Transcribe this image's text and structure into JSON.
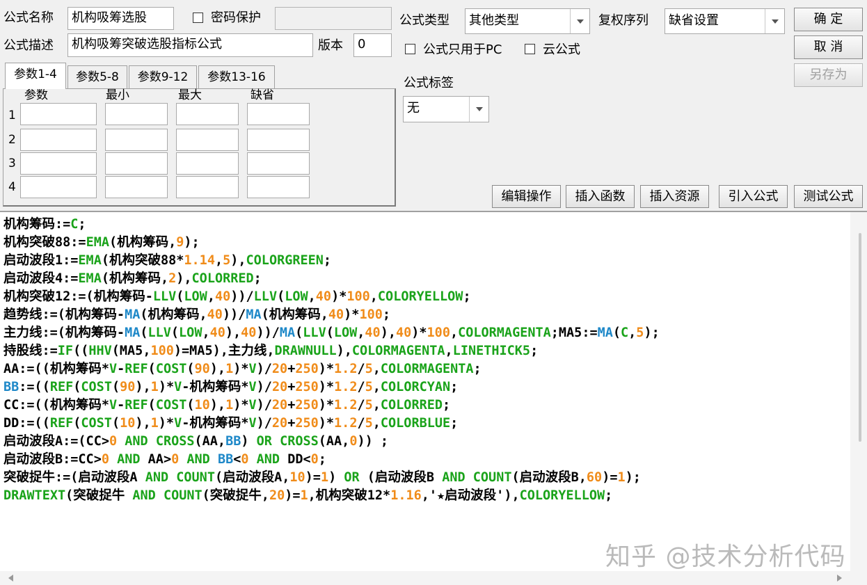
{
  "form": {
    "name_label": "公式名称",
    "name_value": "机构吸筹选股",
    "password_label": "密码保护",
    "password_value": "",
    "desc_label": "公式描述",
    "desc_value": "机构吸筹突破选股指标公式",
    "version_label": "版本",
    "version_value": "0"
  },
  "right": {
    "type_label": "公式类型",
    "type_value": "其他类型",
    "rights_label": "复权序列",
    "rights_value": "缺省设置",
    "pc_only_label": "公式只用于PC",
    "cloud_label": "云公式",
    "tag_label": "公式标签",
    "tag_value": "无"
  },
  "buttons": {
    "ok": "确  定",
    "cancel": "取  消",
    "save_as": "另存为",
    "edit_ops": "编辑操作",
    "insert_func": "插入函数",
    "insert_res": "插入资源",
    "import_formula": "引入公式",
    "test_formula": "测试公式"
  },
  "params": {
    "tabs": [
      "参数1-4",
      "参数5-8",
      "参数9-12",
      "参数13-16"
    ],
    "active_tab": 0,
    "headers": [
      "参数",
      "最小",
      "最大",
      "缺省"
    ],
    "rows": [
      "1",
      "2",
      "3",
      "4"
    ]
  },
  "colors": {
    "default": "#000000",
    "func": "#1aa31a",
    "num": "#f08c1a",
    "blue": "#1e88c8",
    "comment": "#000000"
  },
  "code_lines": [
    [
      [
        "机构筹码:=",
        "default"
      ],
      [
        "C",
        "func"
      ],
      [
        ";",
        "default"
      ]
    ],
    [
      [
        "机构突破88:=",
        "default"
      ],
      [
        "EMA",
        "func"
      ],
      [
        "(机构筹码,",
        "default"
      ],
      [
        "9",
        "num"
      ],
      [
        ");",
        "default"
      ]
    ],
    [
      [
        "启动波段1:=",
        "default"
      ],
      [
        "EMA",
        "func"
      ],
      [
        "(机构突破88*",
        "default"
      ],
      [
        "1.14",
        "num"
      ],
      [
        ",",
        "default"
      ],
      [
        "5",
        "num"
      ],
      [
        "),",
        "default"
      ],
      [
        "COLORGREEN",
        "func"
      ],
      [
        ";",
        "default"
      ]
    ],
    [
      [
        "启动波段4:=",
        "default"
      ],
      [
        "EMA",
        "func"
      ],
      [
        "(机构筹码,",
        "default"
      ],
      [
        "2",
        "num"
      ],
      [
        "),",
        "default"
      ],
      [
        "COLORRED",
        "func"
      ],
      [
        ";",
        "default"
      ]
    ],
    [
      [
        "机构突破12:=(机构筹码-",
        "default"
      ],
      [
        "LLV",
        "func"
      ],
      [
        "(",
        "default"
      ],
      [
        "LOW",
        "func"
      ],
      [
        ",",
        "default"
      ],
      [
        "40",
        "num"
      ],
      [
        "))/",
        "default"
      ],
      [
        "LLV",
        "func"
      ],
      [
        "(",
        "default"
      ],
      [
        "LOW",
        "func"
      ],
      [
        ",",
        "default"
      ],
      [
        "40",
        "num"
      ],
      [
        ")*",
        "default"
      ],
      [
        "100",
        "num"
      ],
      [
        ",",
        "default"
      ],
      [
        "COLORYELLOW",
        "func"
      ],
      [
        ";",
        "default"
      ]
    ],
    [
      [
        "趋势线:=(机构筹码-",
        "default"
      ],
      [
        "MA",
        "blue"
      ],
      [
        "(机构筹码,",
        "default"
      ],
      [
        "40",
        "num"
      ],
      [
        "))/",
        "default"
      ],
      [
        "MA",
        "blue"
      ],
      [
        "(机构筹码,",
        "default"
      ],
      [
        "40",
        "num"
      ],
      [
        ")*",
        "default"
      ],
      [
        "100",
        "num"
      ],
      [
        ";",
        "default"
      ]
    ],
    [
      [
        "主力线:=(机构筹码-",
        "default"
      ],
      [
        "MA",
        "blue"
      ],
      [
        "(",
        "default"
      ],
      [
        "LLV",
        "func"
      ],
      [
        "(",
        "default"
      ],
      [
        "LOW",
        "func"
      ],
      [
        ",",
        "default"
      ],
      [
        "40",
        "num"
      ],
      [
        "),",
        "default"
      ],
      [
        "40",
        "num"
      ],
      [
        "))/",
        "default"
      ],
      [
        "MA",
        "blue"
      ],
      [
        "(",
        "default"
      ],
      [
        "LLV",
        "func"
      ],
      [
        "(",
        "default"
      ],
      [
        "LOW",
        "func"
      ],
      [
        ",",
        "default"
      ],
      [
        "40",
        "num"
      ],
      [
        "),",
        "default"
      ],
      [
        "40",
        "num"
      ],
      [
        ")*",
        "default"
      ],
      [
        "100",
        "num"
      ],
      [
        ",",
        "default"
      ],
      [
        "COLORMAGENTA",
        "func"
      ],
      [
        ";MA5:=",
        "default"
      ],
      [
        "MA",
        "blue"
      ],
      [
        "(",
        "default"
      ],
      [
        "C",
        "func"
      ],
      [
        ",",
        "default"
      ],
      [
        "5",
        "num"
      ],
      [
        ");",
        "default"
      ]
    ],
    [
      [
        "持股线:=",
        "default"
      ],
      [
        "IF",
        "func"
      ],
      [
        "((",
        "default"
      ],
      [
        "HHV",
        "func"
      ],
      [
        "(MA5,",
        "default"
      ],
      [
        "100",
        "num"
      ],
      [
        ")=MA5),主力线,",
        "default"
      ],
      [
        "DRAWNULL",
        "func"
      ],
      [
        "),",
        "default"
      ],
      [
        "COLORMAGENTA",
        "func"
      ],
      [
        ",",
        "default"
      ],
      [
        "LINETHICK5",
        "func"
      ],
      [
        ";",
        "default"
      ]
    ],
    [
      [
        "AA:=((机构筹码*",
        "default"
      ],
      [
        "V",
        "func"
      ],
      [
        "-",
        "default"
      ],
      [
        "REF",
        "func"
      ],
      [
        "(",
        "default"
      ],
      [
        "COST",
        "func"
      ],
      [
        "(",
        "default"
      ],
      [
        "90",
        "num"
      ],
      [
        "),",
        "default"
      ],
      [
        "1",
        "num"
      ],
      [
        ")*",
        "default"
      ],
      [
        "V",
        "func"
      ],
      [
        ")/",
        "default"
      ],
      [
        "20",
        "num"
      ],
      [
        "+",
        "default"
      ],
      [
        "250",
        "num"
      ],
      [
        ")*",
        "default"
      ],
      [
        "1.2",
        "num"
      ],
      [
        "/",
        "default"
      ],
      [
        "5",
        "num"
      ],
      [
        ",",
        "default"
      ],
      [
        "COLORMAGENTA",
        "func"
      ],
      [
        ";",
        "default"
      ]
    ],
    [
      [
        "BB",
        "blue"
      ],
      [
        ":=((",
        "default"
      ],
      [
        "REF",
        "func"
      ],
      [
        "(",
        "default"
      ],
      [
        "COST",
        "func"
      ],
      [
        "(",
        "default"
      ],
      [
        "90",
        "num"
      ],
      [
        "),",
        "default"
      ],
      [
        "1",
        "num"
      ],
      [
        ")*",
        "default"
      ],
      [
        "V",
        "func"
      ],
      [
        "-机构筹码*",
        "default"
      ],
      [
        "V",
        "func"
      ],
      [
        ")/",
        "default"
      ],
      [
        "20",
        "num"
      ],
      [
        "+",
        "default"
      ],
      [
        "250",
        "num"
      ],
      [
        ")*",
        "default"
      ],
      [
        "1.2",
        "num"
      ],
      [
        "/",
        "default"
      ],
      [
        "5",
        "num"
      ],
      [
        ",",
        "default"
      ],
      [
        "COLORCYAN",
        "func"
      ],
      [
        ";",
        "default"
      ]
    ],
    [
      [
        "CC:=((机构筹码*",
        "default"
      ],
      [
        "V",
        "func"
      ],
      [
        "-",
        "default"
      ],
      [
        "REF",
        "func"
      ],
      [
        "(",
        "default"
      ],
      [
        "COST",
        "func"
      ],
      [
        "(",
        "default"
      ],
      [
        "10",
        "num"
      ],
      [
        "),",
        "default"
      ],
      [
        "1",
        "num"
      ],
      [
        ")*",
        "default"
      ],
      [
        "V",
        "func"
      ],
      [
        ")/",
        "default"
      ],
      [
        "20",
        "num"
      ],
      [
        "+",
        "default"
      ],
      [
        "250",
        "num"
      ],
      [
        ")*",
        "default"
      ],
      [
        "1.2",
        "num"
      ],
      [
        "/",
        "default"
      ],
      [
        "5",
        "num"
      ],
      [
        ",",
        "default"
      ],
      [
        "COLORRED",
        "func"
      ],
      [
        ";",
        "default"
      ]
    ],
    [
      [
        "DD:=((",
        "default"
      ],
      [
        "REF",
        "func"
      ],
      [
        "(",
        "default"
      ],
      [
        "COST",
        "func"
      ],
      [
        "(",
        "default"
      ],
      [
        "10",
        "num"
      ],
      [
        "),",
        "default"
      ],
      [
        "1",
        "num"
      ],
      [
        ")*",
        "default"
      ],
      [
        "V",
        "func"
      ],
      [
        "-机构筹码*",
        "default"
      ],
      [
        "V",
        "func"
      ],
      [
        ")/",
        "default"
      ],
      [
        "20",
        "num"
      ],
      [
        "+",
        "default"
      ],
      [
        "250",
        "num"
      ],
      [
        ")*",
        "default"
      ],
      [
        "1.2",
        "num"
      ],
      [
        "/",
        "default"
      ],
      [
        "5",
        "num"
      ],
      [
        ",",
        "default"
      ],
      [
        "COLORBLUE",
        "func"
      ],
      [
        ";",
        "default"
      ]
    ],
    [
      [
        "启动波段A:=(CC>",
        "default"
      ],
      [
        "0",
        "num"
      ],
      [
        " ",
        "default"
      ],
      [
        "AND",
        "func"
      ],
      [
        " ",
        "default"
      ],
      [
        "CROSS",
        "func"
      ],
      [
        "(AA,",
        "default"
      ],
      [
        "BB",
        "blue"
      ],
      [
        ") ",
        "default"
      ],
      [
        "OR",
        "func"
      ],
      [
        " ",
        "default"
      ],
      [
        "CROSS",
        "func"
      ],
      [
        "(AA,",
        "default"
      ],
      [
        "0",
        "num"
      ],
      [
        ")) ;",
        "default"
      ]
    ],
    [
      [
        "启动波段B:=CC>",
        "default"
      ],
      [
        "0",
        "num"
      ],
      [
        " ",
        "default"
      ],
      [
        "AND",
        "func"
      ],
      [
        " AA>",
        "default"
      ],
      [
        "0",
        "num"
      ],
      [
        " ",
        "default"
      ],
      [
        "AND",
        "func"
      ],
      [
        " ",
        "default"
      ],
      [
        "BB",
        "blue"
      ],
      [
        "<",
        "default"
      ],
      [
        "0",
        "num"
      ],
      [
        " ",
        "default"
      ],
      [
        "AND",
        "func"
      ],
      [
        " DD<",
        "default"
      ],
      [
        "0",
        "num"
      ],
      [
        ";",
        "default"
      ]
    ],
    [
      [
        "突破捉牛:=(启动波段A ",
        "default"
      ],
      [
        "AND",
        "func"
      ],
      [
        " ",
        "default"
      ],
      [
        "COUNT",
        "func"
      ],
      [
        "(启动波段A,",
        "default"
      ],
      [
        "10",
        "num"
      ],
      [
        ")=",
        "default"
      ],
      [
        "1",
        "num"
      ],
      [
        ") ",
        "default"
      ],
      [
        "OR",
        "func"
      ],
      [
        " (启动波段B ",
        "default"
      ],
      [
        "AND",
        "func"
      ],
      [
        " ",
        "default"
      ],
      [
        "COUNT",
        "func"
      ],
      [
        "(启动波段B,",
        "default"
      ],
      [
        "60",
        "num"
      ],
      [
        ")=",
        "default"
      ],
      [
        "1",
        "num"
      ],
      [
        ");",
        "default"
      ]
    ],
    [
      [
        "DRAWTEXT",
        "func"
      ],
      [
        "(突破捉牛 ",
        "default"
      ],
      [
        "AND",
        "func"
      ],
      [
        " ",
        "default"
      ],
      [
        "COUNT",
        "func"
      ],
      [
        "(突破捉牛,",
        "default"
      ],
      [
        "20",
        "num"
      ],
      [
        ")=",
        "default"
      ],
      [
        "1",
        "num"
      ],
      [
        ",机构突破12*",
        "default"
      ],
      [
        "1.16",
        "num"
      ],
      [
        ",'★启动波段'),",
        "default"
      ],
      [
        "COLORYELLOW",
        "func"
      ],
      [
        ";",
        "default"
      ]
    ]
  ],
  "watermark": "知乎 @技术分析代码"
}
